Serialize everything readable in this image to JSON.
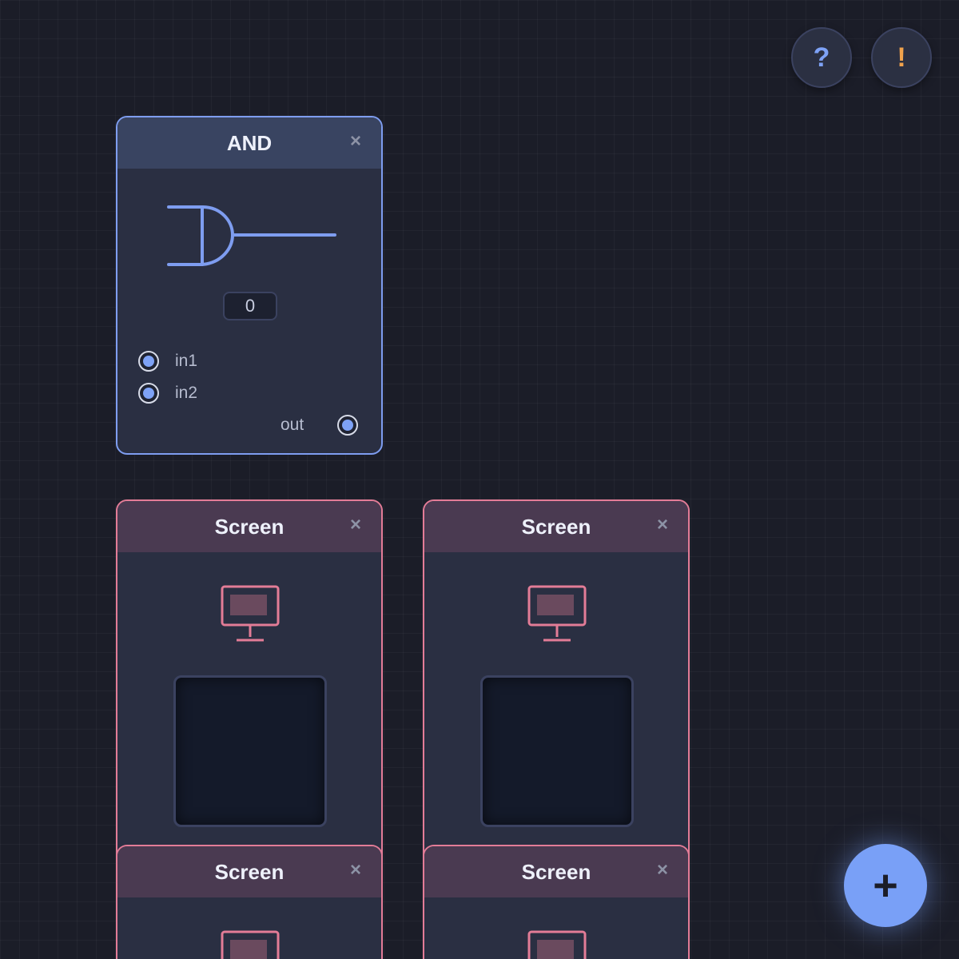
{
  "toolbar": {
    "help_label": "?",
    "alert_label": "!",
    "add_label": "+"
  },
  "nodes": {
    "and_gate": {
      "title": "AND",
      "close_label": "×",
      "value": "0",
      "inputs": [
        "in1",
        "in2"
      ],
      "output": "out"
    },
    "screens": [
      {
        "title": "Screen",
        "close_label": "×"
      },
      {
        "title": "Screen",
        "close_label": "×"
      },
      {
        "title": "Screen",
        "close_label": "×"
      },
      {
        "title": "Screen",
        "close_label": "×"
      }
    ]
  },
  "colors": {
    "background": "#1b1d28",
    "logic_accent": "#7e9df0",
    "screen_accent": "#e37c97",
    "warning": "#f0a24c",
    "fab": "#79a0f7"
  },
  "icons": {
    "help": "question-mark-icon",
    "alert": "exclamation-icon",
    "gate": "and-gate-icon",
    "screen": "monitor-icon",
    "close": "close-icon",
    "add": "plus-icon"
  }
}
